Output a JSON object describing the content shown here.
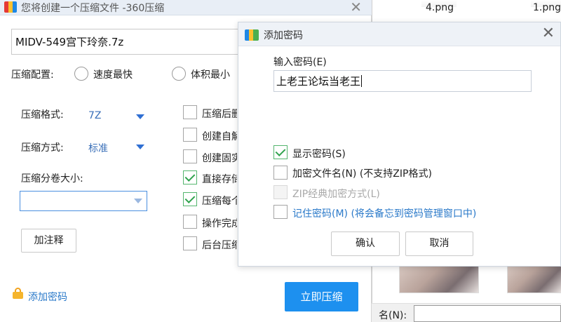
{
  "background_explorer": {
    "file_labels": [
      "4.png",
      "1.png"
    ],
    "name_label": "名(N):",
    "name_value": ""
  },
  "main_window": {
    "title": "您将创建一个压缩文件 -360压缩",
    "archive_name": "MIDV-549宫下玲奈.7z",
    "compress_config_label": "压缩配置:",
    "radio_fastest": "速度最快",
    "radio_smallest": "体积最小",
    "format_label": "压缩格式:",
    "format_value": "7Z",
    "method_label": "压缩方式:",
    "method_value": "标准",
    "volume_label": "压缩分卷大小:",
    "volume_value": "",
    "options": [
      {
        "label": "压缩后删",
        "checked": false
      },
      {
        "label": "创建自解",
        "checked": false
      },
      {
        "label": "创建固实",
        "checked": false
      },
      {
        "label": "直接存储",
        "checked": true
      },
      {
        "label": "压缩每个",
        "checked": true
      },
      {
        "label": "操作完成",
        "checked": false
      },
      {
        "label": "后台压缩",
        "checked": false
      }
    ],
    "comment_button": "加注释",
    "add_password_link": "添加密码",
    "compress_now_button": "立即压缩"
  },
  "password_dialog": {
    "title": "添加密码",
    "password_label": "输入密码(E)",
    "password_value": "上老王论坛当老王",
    "show_password": {
      "label": "显示密码(S)",
      "checked": true
    },
    "encrypt_filenames": {
      "label": "加密文件名(N) (不支持ZIP格式)",
      "checked": false
    },
    "zip_classic": {
      "label": "ZIP经典加密方式(L)",
      "checked": false,
      "disabled": true
    },
    "remember_password": {
      "label": "记住密码(M) (将会备忘到密码管理窗口中)",
      "checked": false
    },
    "ok_button": "确认",
    "cancel_button": "取消"
  },
  "colors": {
    "primary_button": "#1d90ef",
    "link": "#2a79c9",
    "check": "#2fa24d"
  }
}
